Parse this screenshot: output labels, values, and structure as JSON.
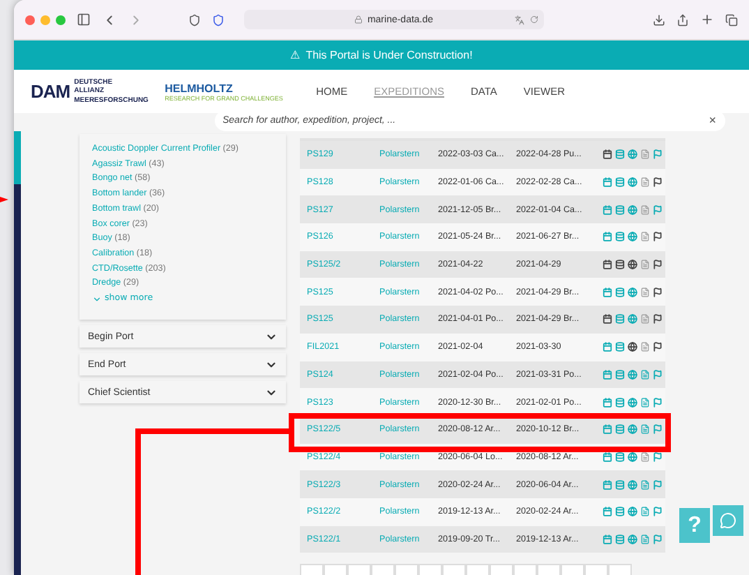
{
  "browser": {
    "url": "marine-data.de"
  },
  "banner": {
    "icon": "⚠",
    "text": "This Portal is Under Construction!"
  },
  "header": {
    "logo_left": {
      "mark": "DAM",
      "caption": "DEUTSCHE ALLIANZ MEERESFORSCHUNG"
    },
    "logo_right": {
      "name": "HELMHOLTZ",
      "tagline": "RESEARCH FOR GRAND CHALLENGES"
    },
    "nav": [
      {
        "label": "HOME",
        "selected": false
      },
      {
        "label": "EXPEDITIONS",
        "selected": true
      },
      {
        "label": "DATA",
        "selected": false
      },
      {
        "label": "VIEWER",
        "selected": false
      }
    ]
  },
  "search": {
    "placeholder": "Search for author, expedition, project, ...",
    "clear": "×"
  },
  "sidebar": {
    "devices": [
      {
        "name": "Acoustic Doppler Current Profiler",
        "count": "(29)"
      },
      {
        "name": "Agassiz Trawl",
        "count": "(43)"
      },
      {
        "name": "Bongo net",
        "count": "(58)"
      },
      {
        "name": "Bottom lander",
        "count": "(36)"
      },
      {
        "name": "Bottom trawl",
        "count": "(20)"
      },
      {
        "name": "Box corer",
        "count": "(23)"
      },
      {
        "name": "Buoy",
        "count": "(18)"
      },
      {
        "name": "Calibration",
        "count": "(18)"
      },
      {
        "name": "CTD/Rosette",
        "count": "(203)"
      },
      {
        "name": "Dredge",
        "count": "(29)"
      }
    ],
    "show_more": "show more",
    "filters": [
      {
        "label": "Begin Port",
        "expanded": false
      },
      {
        "label": "End Port",
        "expanded": false
      },
      {
        "label": "Chief Scientist",
        "expanded": false
      }
    ]
  },
  "table": {
    "rows": [
      {
        "id": "PS129",
        "ship": "Polarstern",
        "begin": "2022-03-03 Ca...",
        "end": "2022-04-28 Pu...",
        "links": [
          false,
          true,
          true,
          false,
          true
        ],
        "highlighted": false
      },
      {
        "id": "PS128",
        "ship": "Polarstern",
        "begin": "2022-01-06 Ca...",
        "end": "2022-02-28 Ca...",
        "links": [
          true,
          true,
          true,
          false,
          false
        ],
        "highlighted": false
      },
      {
        "id": "PS127",
        "ship": "Polarstern",
        "begin": "2021-12-05 Br...",
        "end": "2022-01-04 Ca...",
        "links": [
          true,
          true,
          true,
          false,
          true
        ],
        "highlighted": false
      },
      {
        "id": "PS126",
        "ship": "Polarstern",
        "begin": "2021-05-24 Br...",
        "end": "2021-06-27 Br...",
        "links": [
          true,
          true,
          true,
          false,
          false
        ],
        "highlighted": false
      },
      {
        "id": "PS125/2",
        "ship": "Polarstern",
        "begin": "2021-04-22",
        "end": "2021-04-29",
        "links": [
          false,
          false,
          false,
          false,
          false
        ],
        "highlighted": false
      },
      {
        "id": "PS125",
        "ship": "Polarstern",
        "begin": "2021-04-02 Po...",
        "end": "2021-04-29 Br...",
        "links": [
          true,
          true,
          true,
          false,
          false
        ],
        "highlighted": false
      },
      {
        "id": "PS125",
        "ship": "Polarstern",
        "begin": "2021-04-01 Po...",
        "end": "2021-04-29 Br...",
        "links": [
          false,
          true,
          true,
          false,
          false
        ],
        "highlighted": false
      },
      {
        "id": "FIL2021",
        "ship": "Polarstern",
        "begin": "2021-02-04",
        "end": "2021-03-30",
        "links": [
          true,
          true,
          false,
          false,
          false
        ],
        "highlighted": false
      },
      {
        "id": "PS124",
        "ship": "Polarstern",
        "begin": "2021-02-04 Po...",
        "end": "2021-03-31 Po...",
        "links": [
          true,
          true,
          true,
          true,
          true
        ],
        "highlighted": false
      },
      {
        "id": "PS123",
        "ship": "Polarstern",
        "begin": "2020-12-30 Br...",
        "end": "2021-02-01 Po...",
        "links": [
          true,
          true,
          true,
          true,
          true
        ],
        "highlighted": false
      },
      {
        "id": "PS122/5",
        "ship": "Polarstern",
        "begin": "2020-08-12 Ar...",
        "end": "2020-10-12 Br...",
        "links": [
          true,
          true,
          true,
          true,
          true
        ],
        "highlighted": true
      },
      {
        "id": "PS122/4",
        "ship": "Polarstern",
        "begin": "2020-06-04 Lo...",
        "end": "2020-08-12 Ar...",
        "links": [
          true,
          true,
          true,
          false,
          true
        ],
        "highlighted": false
      },
      {
        "id": "PS122/3",
        "ship": "Polarstern",
        "begin": "2020-02-24 Ar...",
        "end": "2020-06-04 Ar...",
        "links": [
          true,
          true,
          true,
          true,
          true
        ],
        "highlighted": false
      },
      {
        "id": "PS122/2",
        "ship": "Polarstern",
        "begin": "2019-12-13 Ar...",
        "end": "2020-02-24 Ar...",
        "links": [
          true,
          true,
          true,
          true,
          true
        ],
        "highlighted": false
      },
      {
        "id": "PS122/1",
        "ship": "Polarstern",
        "begin": "2019-09-20 Tr...",
        "end": "2019-12-13 Ar...",
        "links": [
          true,
          true,
          true,
          true,
          true
        ],
        "highlighted": false
      }
    ]
  },
  "help": {
    "label": "?"
  }
}
